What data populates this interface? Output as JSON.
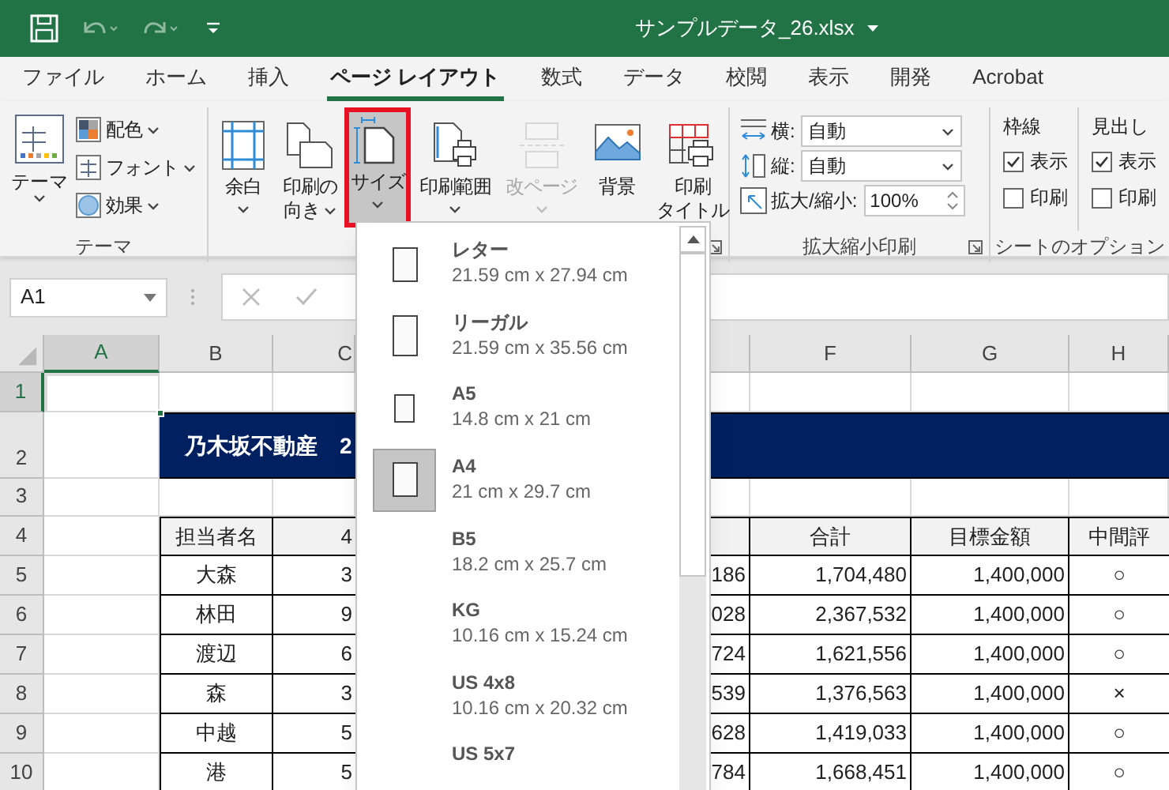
{
  "title_bar": {
    "title": "サンプルデータ_26.xlsx"
  },
  "tabs": [
    {
      "label": "ファイル",
      "selected": false
    },
    {
      "label": "ホーム",
      "selected": false
    },
    {
      "label": "挿入",
      "selected": false
    },
    {
      "label": "ページ レイアウト",
      "selected": true
    },
    {
      "label": "数式",
      "selected": false
    },
    {
      "label": "データ",
      "selected": false
    },
    {
      "label": "校閲",
      "selected": false
    },
    {
      "label": "表示",
      "selected": false
    },
    {
      "label": "開発",
      "selected": false
    },
    {
      "label": "Acrobat",
      "selected": false
    }
  ],
  "ribbon": {
    "themes": {
      "button": "テーマ",
      "items": [
        {
          "kind": "colors",
          "label": "配色"
        },
        {
          "kind": "fonts",
          "label": "フォント"
        },
        {
          "kind": "effects",
          "label": "効果"
        }
      ],
      "label": "テーマ"
    },
    "page_setup": {
      "buttons": [
        {
          "kind": "margins",
          "lines": [
            "余白"
          ],
          "dropdown": true,
          "selected": false,
          "disabled": false
        },
        {
          "kind": "orientation",
          "lines": [
            "印刷の",
            "向き"
          ],
          "dropdown": true,
          "selected": false,
          "disabled": false
        },
        {
          "kind": "size",
          "lines": [
            "サイズ"
          ],
          "dropdown": true,
          "selected": true,
          "disabled": false
        },
        {
          "kind": "print_area",
          "lines": [
            "印刷範囲"
          ],
          "dropdown": true,
          "selected": false,
          "disabled": false
        },
        {
          "kind": "breaks",
          "lines": [
            "改ページ"
          ],
          "dropdown": true,
          "selected": false,
          "disabled": true
        },
        {
          "kind": "background",
          "lines": [
            "背景"
          ],
          "dropdown": false,
          "selected": false,
          "disabled": false
        },
        {
          "kind": "print_titles",
          "lines": [
            "印刷",
            "タイトル"
          ],
          "dropdown": false,
          "selected": false,
          "disabled": false
        }
      ]
    },
    "scale": {
      "rows": [
        {
          "kind": "width",
          "label": "横:",
          "value": "自動"
        },
        {
          "kind": "height",
          "label": "縦:",
          "value": "自動"
        },
        {
          "kind": "scale",
          "label": "拡大/縮小:",
          "value": "100%"
        }
      ],
      "label": "拡大縮小印刷"
    },
    "sheet_options": {
      "columns": [
        {
          "heading": "枠線",
          "options": [
            {
              "label": "表示",
              "checked": true
            },
            {
              "label": "印刷",
              "checked": false
            }
          ]
        },
        {
          "heading": "見出し",
          "options": [
            {
              "label": "表示",
              "checked": true
            },
            {
              "label": "印刷",
              "checked": false
            }
          ]
        }
      ],
      "label": "シートのオプション"
    }
  },
  "formula_bar": {
    "name_box": "A1"
  },
  "sheet": {
    "columns": [
      {
        "label": "A",
        "selected": true
      },
      {
        "label": "B",
        "selected": false
      },
      {
        "label": "C",
        "selected": false
      },
      {
        "selected": false
      },
      {
        "label": "F",
        "selected": false
      },
      {
        "label": "G",
        "selected": false
      },
      {
        "label": "H",
        "selected": false
      }
    ],
    "row_numbers": [
      {
        "label": "1",
        "selected": true
      },
      {
        "label": "2",
        "selected": false
      },
      {
        "label": "3",
        "selected": false
      },
      {
        "label": "4",
        "selected": false
      },
      {
        "label": "5",
        "selected": false
      },
      {
        "label": "6",
        "selected": false
      },
      {
        "label": "7",
        "selected": false
      },
      {
        "label": "8",
        "selected": false
      },
      {
        "label": "9",
        "selected": false
      },
      {
        "label": "10",
        "selected": false
      }
    ],
    "title": "乃木坂不動産　2",
    "rows": [
      [
        null,
        "担当者名",
        "4",
        null,
        "合計",
        "目標金額",
        "中間評"
      ],
      [
        null,
        "大森",
        "3",
        "186",
        "1,704,480",
        "1,400,000",
        "○"
      ],
      [
        null,
        "林田",
        "9",
        "028",
        "2,367,532",
        "1,400,000",
        "○"
      ],
      [
        null,
        "渡辺",
        "6",
        "724",
        "1,621,556",
        "1,400,000",
        "○"
      ],
      [
        null,
        "森",
        "3",
        "539",
        "1,376,563",
        "1,400,000",
        "×"
      ],
      [
        null,
        "中越",
        "5",
        "628",
        "1,419,033",
        "1,400,000",
        "○"
      ],
      [
        null,
        "港",
        "5",
        "784",
        "1,668,451",
        "1,400,000",
        "○"
      ]
    ]
  },
  "size_menu": {
    "items": [
      {
        "kind": "letter",
        "name": "レター",
        "dims": "21.59 cm x 27.94 cm",
        "selected": false
      },
      {
        "kind": "legal",
        "name": "リーガル",
        "dims": "21.59 cm x 35.56 cm",
        "selected": false
      },
      {
        "kind": "small",
        "name": "A5",
        "dims": "14.8 cm x 21 cm",
        "selected": false
      },
      {
        "kind": "letter",
        "name": "A4",
        "dims": "21 cm x 29.7 cm",
        "selected": true
      },
      {
        "kind": "none",
        "name": "B5",
        "dims": "18.2 cm x 25.7 cm",
        "selected": false
      },
      {
        "kind": "none",
        "name": "KG",
        "dims": "10.16 cm x 15.24 cm",
        "selected": false
      },
      {
        "kind": "none",
        "name": "US 4x8",
        "dims": "10.16 cm x 20.32 cm",
        "selected": false
      },
      {
        "kind": "none",
        "name": "US 5x7",
        "selected": false
      }
    ]
  }
}
